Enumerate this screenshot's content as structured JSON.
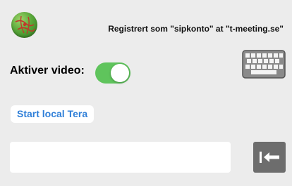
{
  "header": {
    "registration_text": "Registrert som \"sipkonto\" at \"t-meeting.se\"",
    "logo_icon": "globe-logo-icon"
  },
  "keyboard": {
    "icon": "keyboard-icon"
  },
  "video": {
    "label": "Aktiver video:",
    "enabled": true,
    "toggle_color": "#5fc45c"
  },
  "start_button": {
    "label": "Start local Tera",
    "color": "#2f7fd8"
  },
  "input": {
    "value": "",
    "placeholder": ""
  },
  "backspace": {
    "icon": "backspace-arrow-icon",
    "color": "#6d6d6d"
  }
}
